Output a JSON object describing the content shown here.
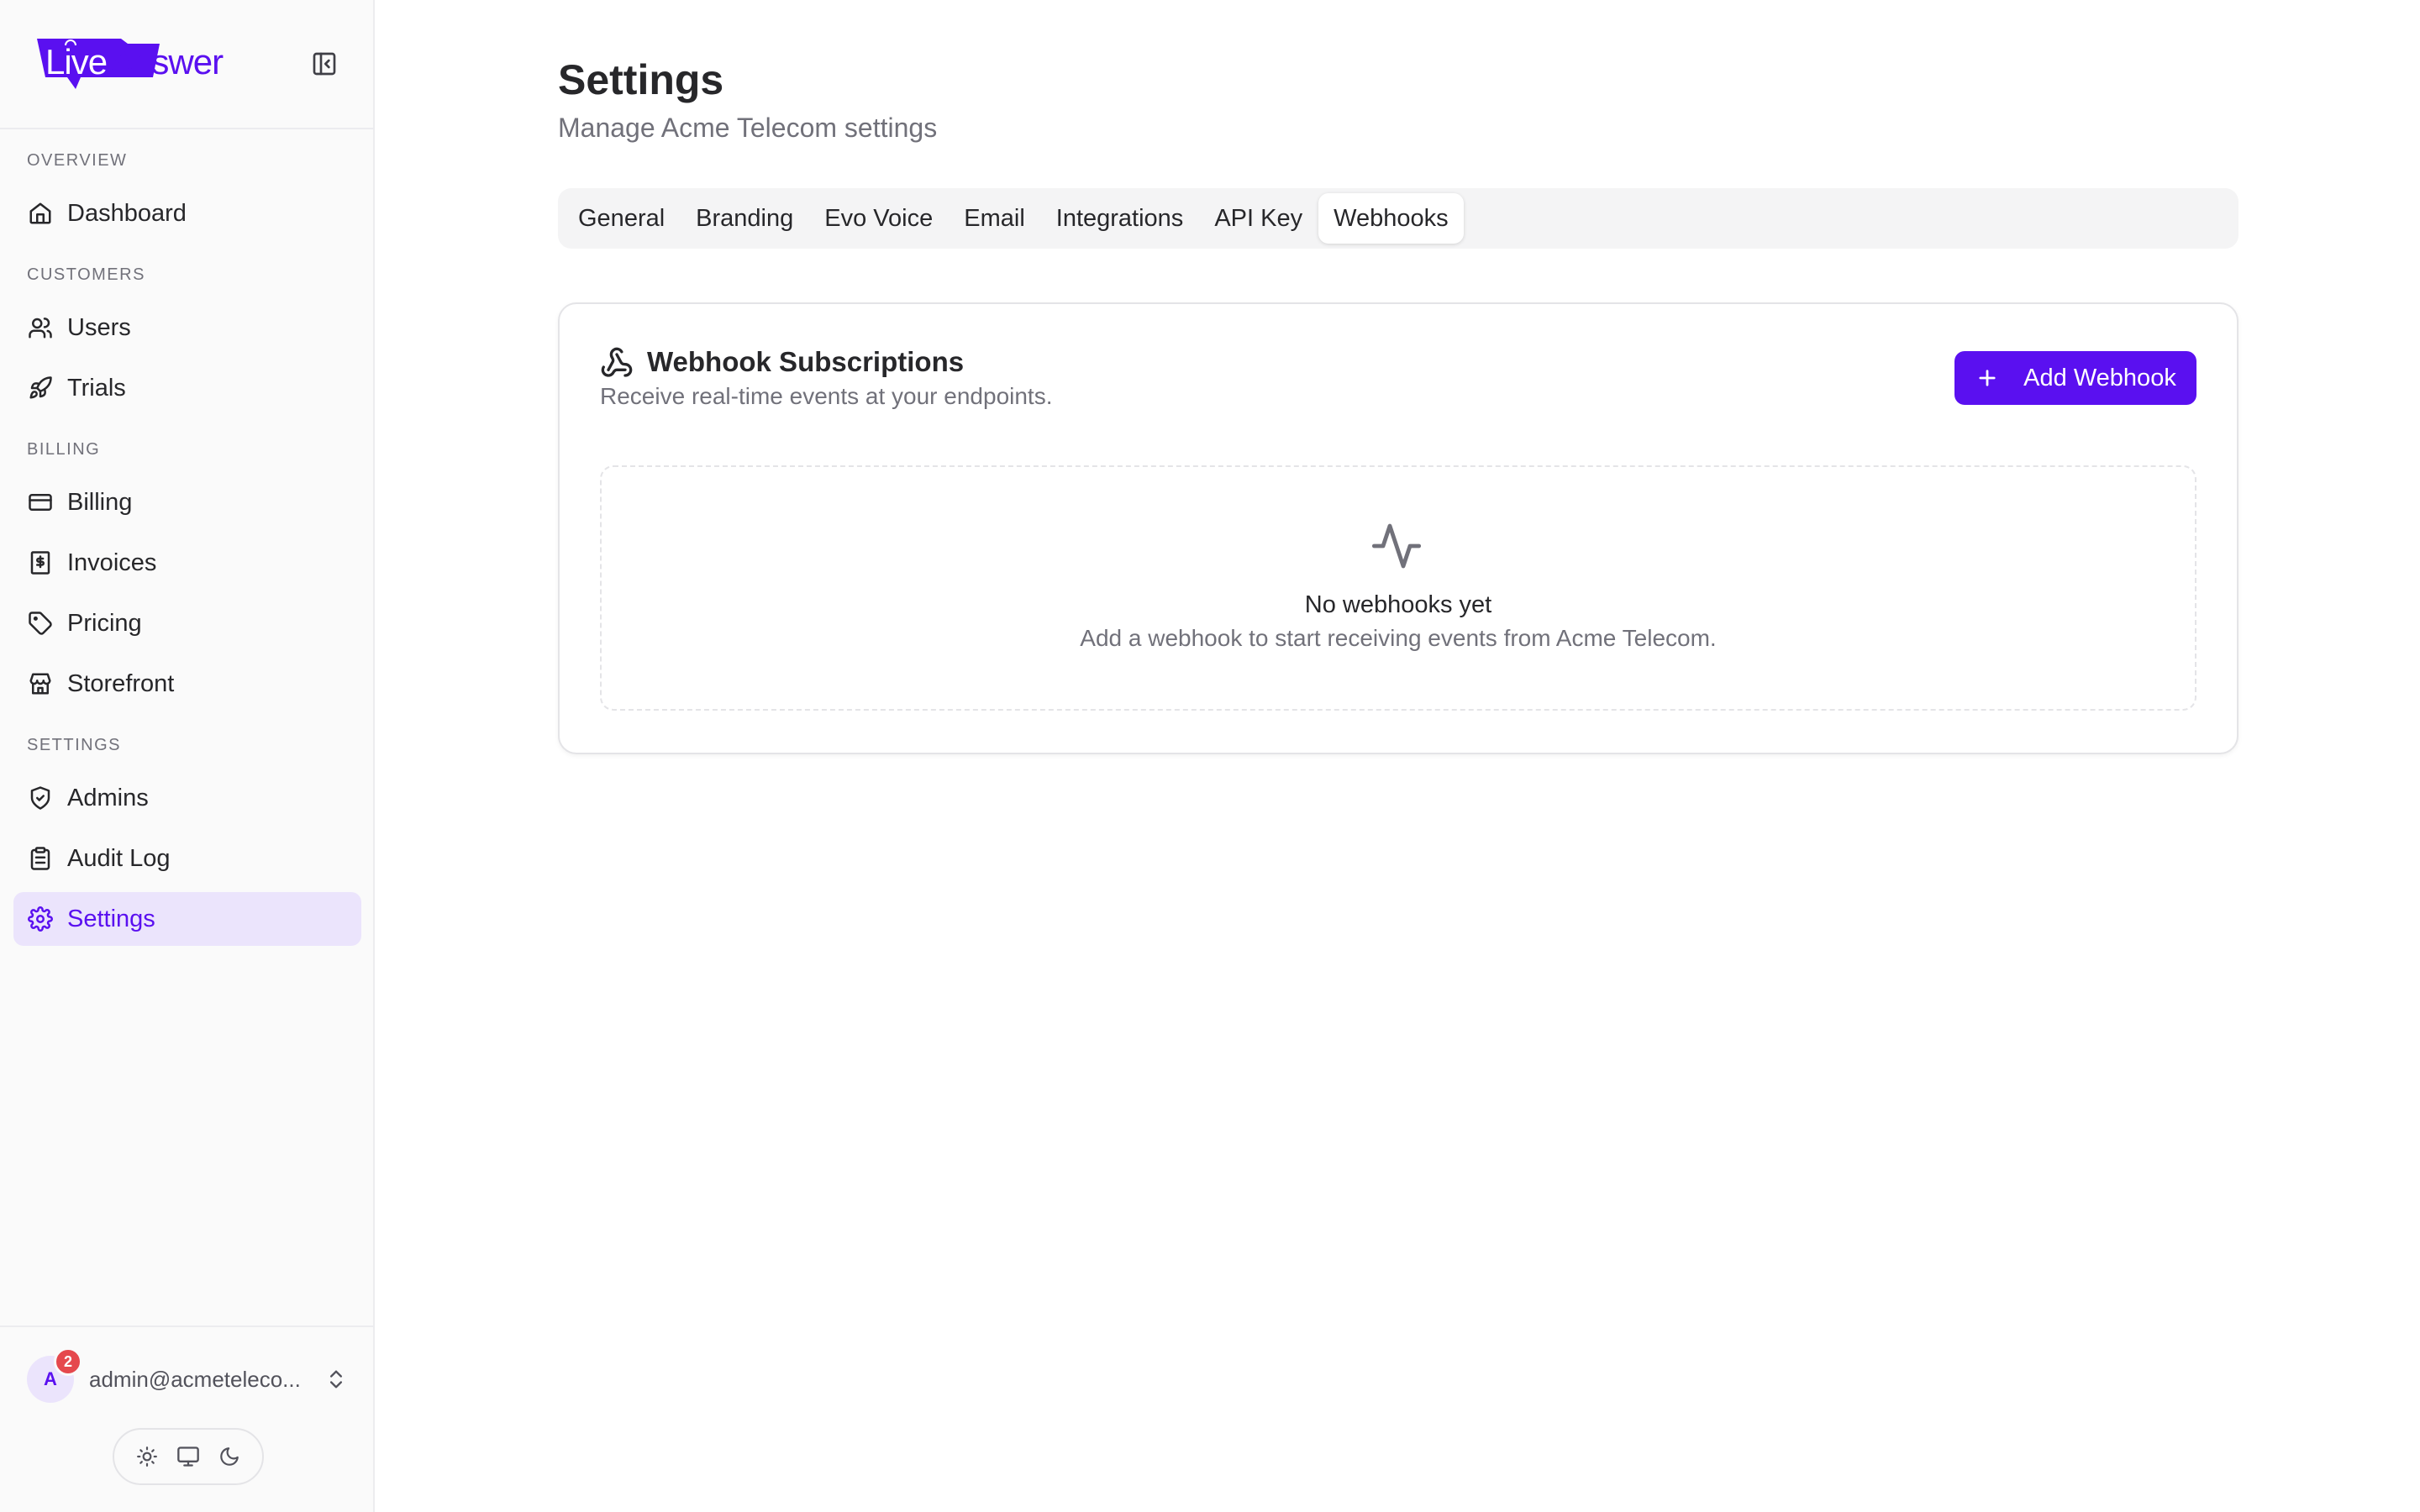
{
  "brand": {
    "part1": "Live",
    "part2": "Answer",
    "accent_color": "#5a10f0"
  },
  "sidebar": {
    "sections": [
      {
        "label": "Overview",
        "items": [
          {
            "label": "Dashboard",
            "icon": "home-icon"
          }
        ]
      },
      {
        "label": "Customers",
        "items": [
          {
            "label": "Users",
            "icon": "users-icon"
          },
          {
            "label": "Trials",
            "icon": "rocket-icon"
          }
        ]
      },
      {
        "label": "Billing",
        "items": [
          {
            "label": "Billing",
            "icon": "credit-card-icon"
          },
          {
            "label": "Invoices",
            "icon": "receipt-icon"
          },
          {
            "label": "Pricing",
            "icon": "tag-icon"
          },
          {
            "label": "Storefront",
            "icon": "store-icon"
          }
        ]
      },
      {
        "label": "Settings",
        "items": [
          {
            "label": "Admins",
            "icon": "shield-icon"
          },
          {
            "label": "Audit Log",
            "icon": "clipboard-icon"
          },
          {
            "label": "Settings",
            "icon": "gear-icon",
            "active": true
          }
        ]
      }
    ],
    "user": {
      "initial": "A",
      "notification_count": "2",
      "email": "admin@acmeteleco..."
    }
  },
  "page": {
    "title": "Settings",
    "subtitle": "Manage Acme Telecom settings"
  },
  "tabs": [
    "General",
    "Branding",
    "Evo Voice",
    "Email",
    "Integrations",
    "API Key",
    "Webhooks"
  ],
  "active_tab": "Webhooks",
  "webhooks": {
    "title": "Webhook Subscriptions",
    "description": "Receive real-time events at your endpoints.",
    "add_button": "Add Webhook",
    "empty_title": "No webhooks yet",
    "empty_description": "Add a webhook to start receiving events from Acme Telecom."
  }
}
